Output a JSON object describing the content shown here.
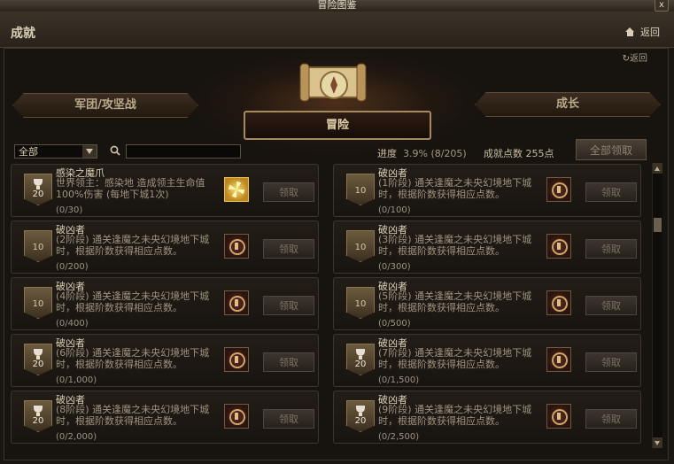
{
  "window": {
    "title": "冒险图鉴",
    "close_label": "x"
  },
  "header": {
    "title": "成就",
    "back_label": "返回"
  },
  "panel": {
    "back_label": "返回"
  },
  "tabs": {
    "left": "军团/攻坚战",
    "center": "冒险",
    "right": "成长"
  },
  "toolbar": {
    "filter_value": "全部",
    "search_value": "",
    "progress_label": "进度",
    "progress_value": "3.9% (8/205)",
    "points_label": "成就点数 255点",
    "claim_all_label": "全部领取"
  },
  "cards": [
    {
      "title": "感染之魔爪",
      "desc": "世界领主：感染地       造成领主生命值100%伤害 (每地下城1次)",
      "progress": "(0/30)",
      "badge": "20",
      "trophy": true,
      "reward": "gold",
      "claim": "领取"
    },
    {
      "title": "破凶者",
      "desc": "(1阶段) 通关逢魔之未央幻境地下城时，根据阶数获得相应点数。",
      "progress": "(0/100)",
      "badge": "10",
      "trophy": false,
      "reward": "emblem",
      "claim": "领取"
    },
    {
      "title": "破凶者",
      "desc": "(2阶段) 通关逢魔之未央幻境地下城时，根据阶数获得相应点数。",
      "progress": "(0/200)",
      "badge": "10",
      "trophy": false,
      "reward": "emblem",
      "claim": "领取"
    },
    {
      "title": "破凶者",
      "desc": "(3阶段) 通关逢魔之未央幻境地下城时，根据阶数获得相应点数。",
      "progress": "(0/300)",
      "badge": "10",
      "trophy": false,
      "reward": "emblem",
      "claim": "领取"
    },
    {
      "title": "破凶者",
      "desc": "(4阶段) 通关逢魔之未央幻境地下城时，根据阶数获得相应点数。",
      "progress": "(0/400)",
      "badge": "10",
      "trophy": false,
      "reward": "emblem",
      "claim": "领取"
    },
    {
      "title": "破凶者",
      "desc": "(5阶段) 通关逢魔之未央幻境地下城时，根据阶数获得相应点数。",
      "progress": "(0/500)",
      "badge": "10",
      "trophy": false,
      "reward": "emblem",
      "claim": "领取"
    },
    {
      "title": "破凶者",
      "desc": "(6阶段) 通关逢魔之未央幻境地下城时，根据阶数获得相应点数。",
      "progress": "(0/1,000)",
      "badge": "20",
      "trophy": true,
      "reward": "emblem",
      "claim": "领取"
    },
    {
      "title": "破凶者",
      "desc": "(7阶段) 通关逢魔之未央幻境地下城时，根据阶数获得相应点数。",
      "progress": "(0/1,500)",
      "badge": "20",
      "trophy": true,
      "reward": "emblem",
      "claim": "领取"
    },
    {
      "title": "破凶者",
      "desc": "(8阶段) 通关逢魔之未央幻境地下城时，根据阶数获得相应点数。",
      "progress": "(0/2,000)",
      "badge": "20",
      "trophy": true,
      "reward": "emblem",
      "claim": "领取"
    },
    {
      "title": "破凶者",
      "desc": "(9阶段) 通关逢魔之未央幻境地下城时，根据阶数获得相应点数。",
      "progress": "(0/2,500)",
      "badge": "20",
      "trophy": true,
      "reward": "emblem",
      "claim": "领取"
    }
  ]
}
